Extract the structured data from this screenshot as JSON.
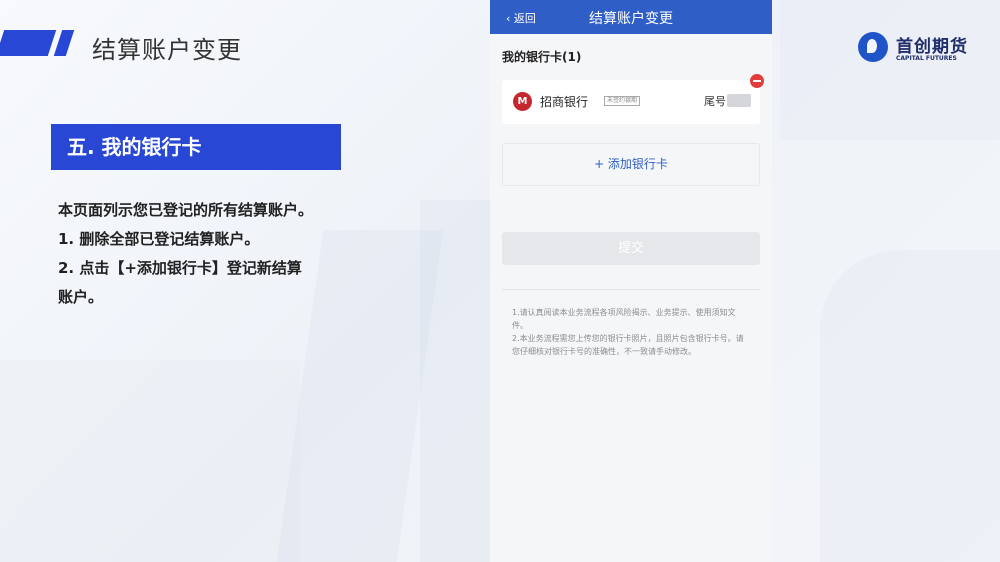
{
  "slide": {
    "title": "结算账户变更",
    "section_heading": "五. 我的银行卡",
    "description": [
      "本页面列示您已登记的所有结算账户。",
      "1. 删除全部已登记结算账户。",
      "2. 点击【+添加银行卡】登记新结算",
      "账户。"
    ]
  },
  "logo": {
    "cn": "首创期货",
    "en": "CAPITAL FUTURES"
  },
  "phone": {
    "nav": {
      "back_label": "‹ 返回",
      "title": "结算账户变更"
    },
    "section_label": "我的银行卡(1)",
    "card": {
      "bank_logo_text": "M",
      "bank_name": "招商银行",
      "tag": "未签约银期",
      "tail_label": "尾号"
    },
    "add_card_label": "+ 添加银行卡",
    "submit_label": "提交",
    "notes": [
      "1.请认真阅读本业务流程各项风险揭示、业务提示、使用须知文件。",
      "2.本业务流程需您上传您的银行卡照片，且照片包含银行卡号。请您仔细核对银行卡号的准确性，不一致请手动修改。"
    ]
  },
  "colors": {
    "brand_blue": "#2747d4",
    "nav_blue": "#2f5fc6",
    "delete_red": "#e23c3c",
    "bank_red": "#c6262e"
  }
}
